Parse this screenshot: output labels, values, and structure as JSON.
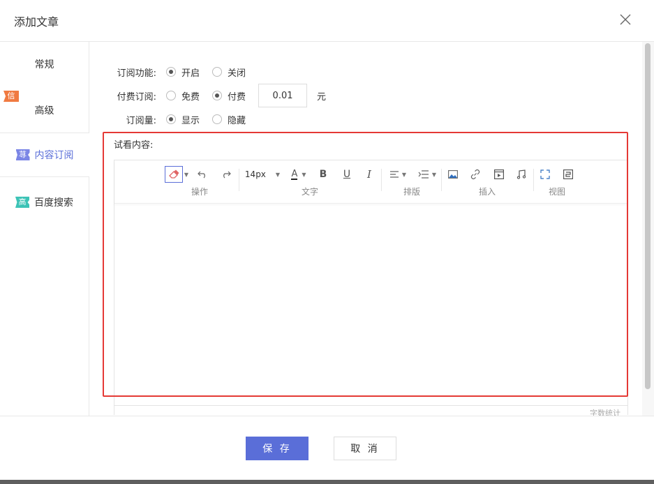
{
  "dialog": {
    "title": "添加文章",
    "close_icon": "close-icon"
  },
  "sidebar": {
    "items": [
      {
        "label": "常规",
        "badge": ""
      },
      {
        "label": "高级",
        "badge": ""
      },
      {
        "label": "内容订阅",
        "badge": "荨"
      },
      {
        "label": "百度搜索",
        "badge": "高"
      }
    ],
    "active_index": 2
  },
  "form": {
    "subscribe": {
      "label": "订阅功能:",
      "options": [
        "开启",
        "关闭"
      ],
      "selected": "开启"
    },
    "paid": {
      "badge": "信",
      "label": "付费订阅:",
      "options": [
        "免费",
        "付费"
      ],
      "selected": "付费",
      "price_value": "0.01",
      "unit": "元"
    },
    "count": {
      "label": "订阅量:",
      "options": [
        "显示",
        "隐藏"
      ],
      "selected": "显示"
    },
    "preview_label": "试看内容:"
  },
  "editor": {
    "groups": {
      "operate": "操作",
      "text": "文字",
      "layout": "排版",
      "insert": "插入",
      "view": "视图"
    },
    "font_size": "14px",
    "bold": "B",
    "underline": "U",
    "italic": "I",
    "font_color": "A",
    "word_count": "字数统计"
  },
  "footer": {
    "save_label": "保 存",
    "cancel_label": "取 消"
  },
  "colors": {
    "accent": "#5a6ed8",
    "highlight": "#e53935",
    "badge_orange": "#f07a41",
    "badge_purple": "#7b86e6",
    "badge_teal": "#3cc3b6"
  }
}
